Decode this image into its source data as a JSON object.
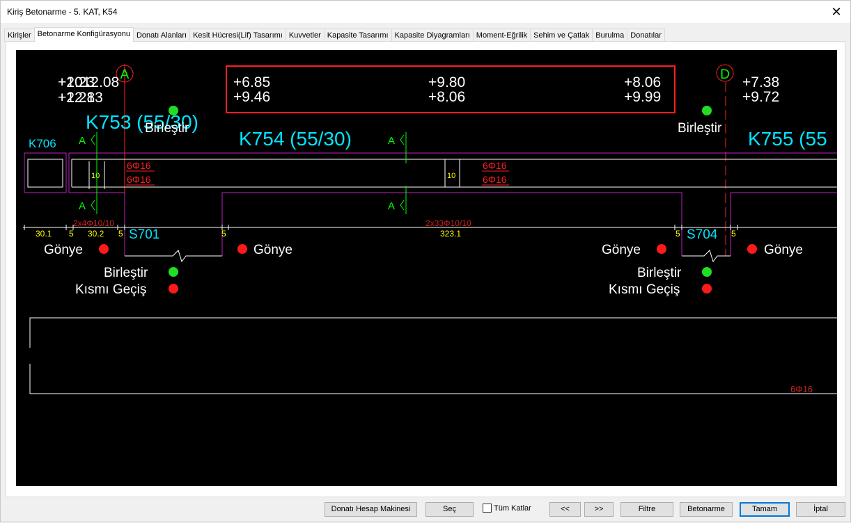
{
  "window": {
    "title": "Kiriş Betonarme - 5. KAT, K54"
  },
  "tabs": [
    "Kirişler",
    "Betonarme Konfigürasyonu",
    "Donatı Alanları",
    "Kesit Hücresi(Lif) Tasarımı",
    "Kuvvetler",
    "Kapasite Tasarımı",
    "Kapasite Diyagramları",
    "Moment-Eğrilik",
    "Sehim ve Çatlak",
    "Burulma",
    "Donatılar"
  ],
  "active_tab": "Betonarme Konfigürasyonu",
  "drawing": {
    "axis_a": "A",
    "axis_d": "D",
    "elev_left_line1": "+1012.08",
    "elev_left_line1b": "+2.23",
    "elev_left_line2": "+12.13",
    "elev_left_line2b": "+2.28",
    "elev_box": [
      [
        "+6.85",
        "+9.80",
        "+8.06"
      ],
      [
        "+9.46",
        "+8.06",
        "+9.99"
      ]
    ],
    "elev_right": [
      "+7.38",
      "+9.72"
    ],
    "beam_k753": "K753 (55/30)",
    "beam_k754": "K754 (55/30)",
    "beam_k755": "K755 (55",
    "beam_k706": "K706",
    "birlestir": "Birleştir",
    "section_mark": "A",
    "rebar_top": "6Φ16",
    "rebar_bottom": "6Φ16",
    "rebar_bottom_right": "6Φ16",
    "dim_10": "10",
    "stirrup_left": "2x4Φ10/10",
    "stirrup_mid": "2x33Φ10/10",
    "dim_30_1": "30.1",
    "dim_5": "5",
    "dim_30_2": "30.2",
    "dim_323_1": "323.1",
    "column_s701": "S701",
    "column_s704": "S704",
    "gonye": "Gönye",
    "kismi_gecis": "Kısmı Geçiş",
    "colors": {
      "cyan": "#00e5ff",
      "green": "#00ff00",
      "red": "#ff2020",
      "magenta": "#c020c0",
      "yellow": "#ffff00",
      "white": "#ffffff",
      "dim_red": "#d02020"
    }
  },
  "buttons": {
    "calc": "Donatı Hesap Makinesi",
    "select": "Seç",
    "all_floors": "Tüm Katlar",
    "prev": "<<",
    "next": ">>",
    "filter": "Filtre",
    "concrete": "Betonarme",
    "ok": "Tamam",
    "cancel": "İptal"
  }
}
